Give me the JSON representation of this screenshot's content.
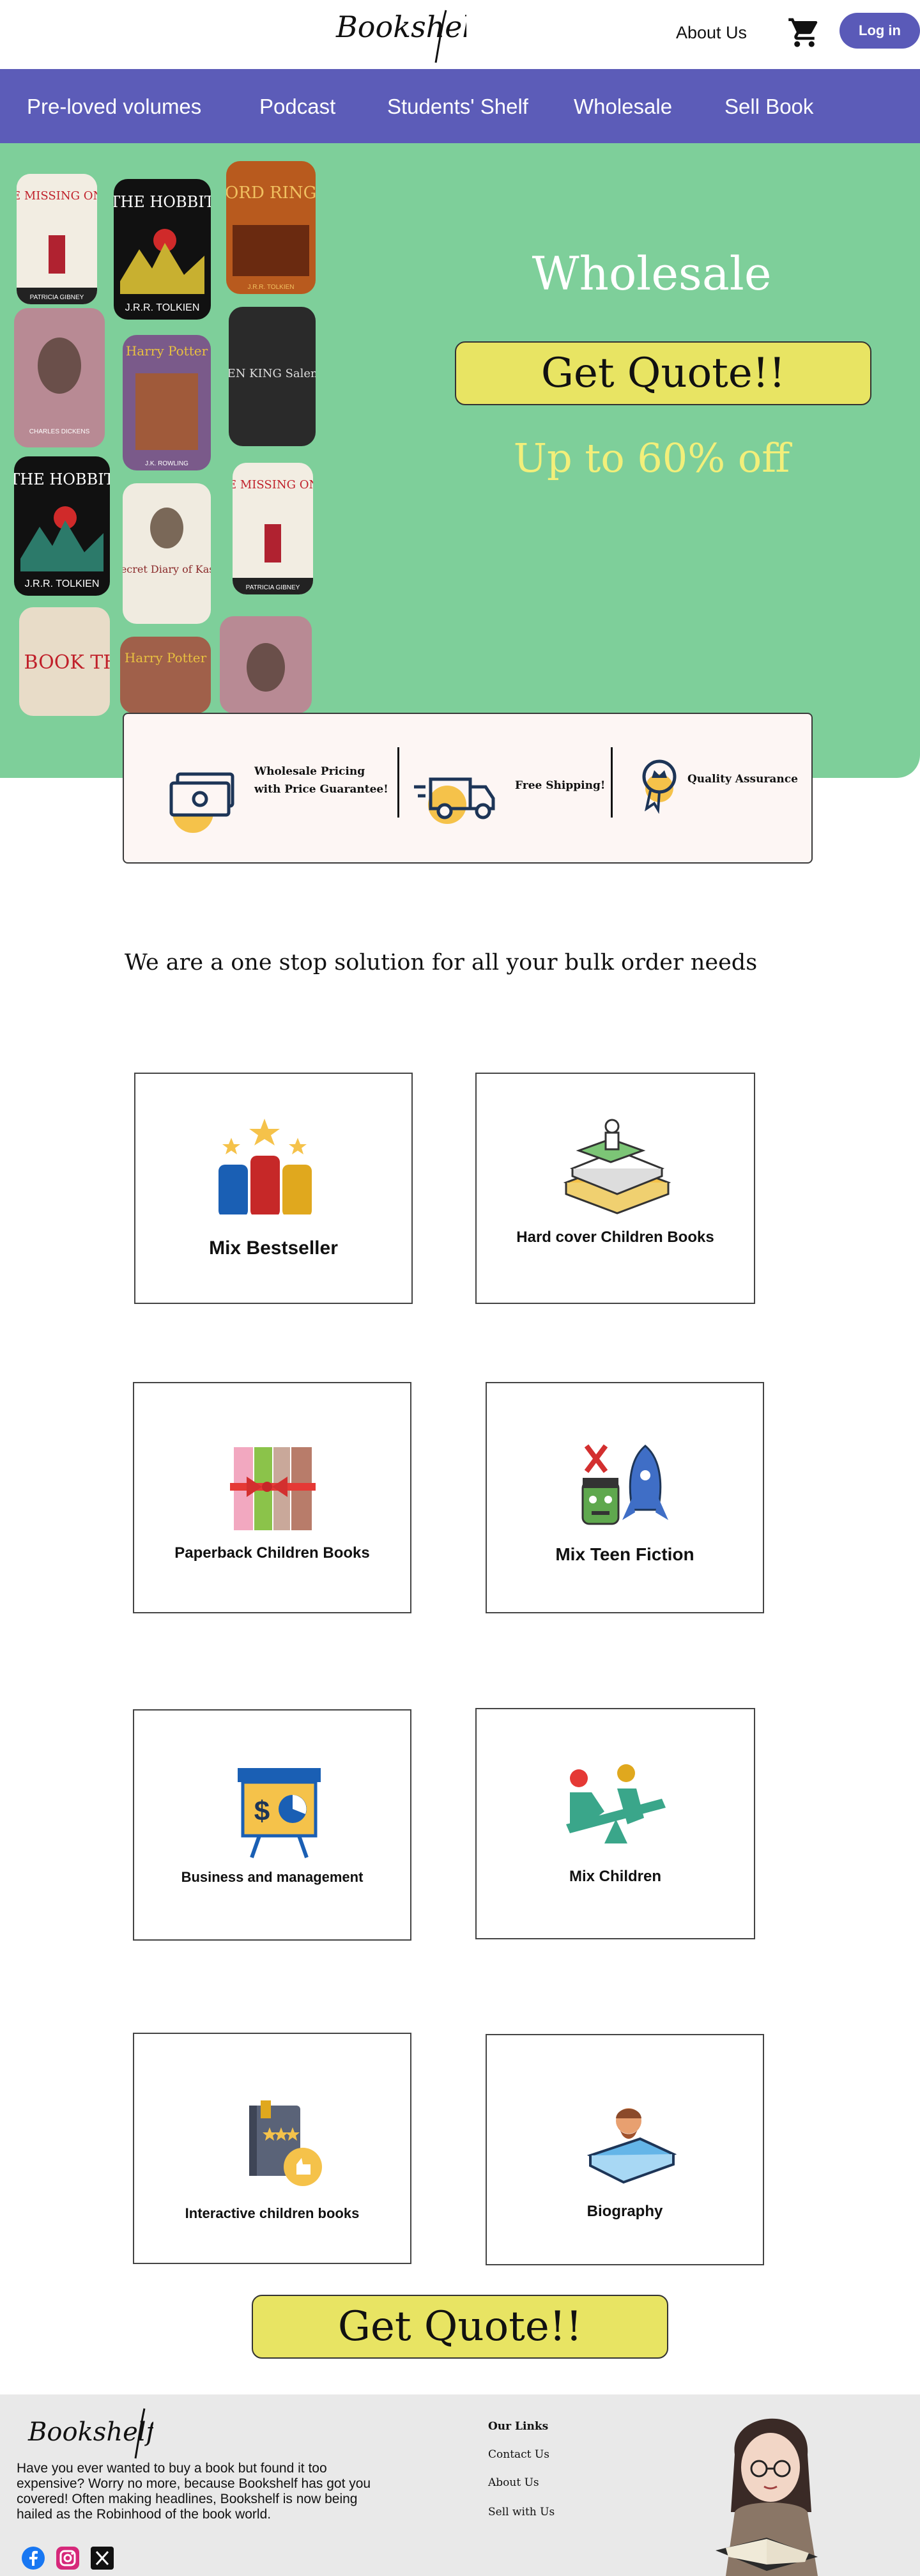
{
  "header": {
    "logo_text": "Bookshelf",
    "about_label": "About Us",
    "login_label": "Log in"
  },
  "nav": {
    "items": [
      "Pre-loved volumes",
      "Podcast",
      "Students' Shelf",
      "Wholesale",
      "Sell Book"
    ]
  },
  "hero": {
    "title": "Wholesale",
    "cta_label": "Get Quote!!",
    "subtitle": "Up to 60% off",
    "book_covers": [
      {
        "title": "THE MISSING ONES",
        "author": "PATRICIA GIBNEY"
      },
      {
        "title": "THE HOBBIT",
        "author": "J.R.R. TOLKIEN"
      },
      {
        "title": "LORD RINGS",
        "author": "J.R.R. TOLKIEN"
      },
      {
        "title": "",
        "author": "CHARLES DICKENS"
      },
      {
        "title": "Harry Potter",
        "author": "J.K. ROWLING"
      },
      {
        "title": "STEPHEN KING Salem's LOT",
        "author": ""
      },
      {
        "title": "THE HOBBIT",
        "author": "J.R.R. TOLKIEN"
      },
      {
        "title": "The Secret Diary of Kasturba",
        "author": ""
      },
      {
        "title": "THE MISSING ONES",
        "author": "PATRICIA GIBNEY"
      },
      {
        "title": "THE BOOK THIEF",
        "author": ""
      },
      {
        "title": "Harry Potter",
        "author": ""
      },
      {
        "title": "",
        "author": ""
      }
    ]
  },
  "features": {
    "pricing": [
      "Wholesale Pricing",
      "with Price Guarantee!"
    ],
    "shipping": "Free Shipping!",
    "quality": "Quality Assurance"
  },
  "tagline": "We are a one stop solution for all your bulk order needs",
  "categories": [
    {
      "label": "Mix Bestseller",
      "icon": "bestseller-icon"
    },
    {
      "label": "Hard cover Children Books",
      "icon": "hardcover-books-icon"
    },
    {
      "label": "Paperback Children Books",
      "icon": "paperback-books-icon"
    },
    {
      "label": "Mix Teen Fiction",
      "icon": "teen-fiction-icon"
    },
    {
      "label": "Business and management",
      "icon": "business-chart-icon"
    },
    {
      "label": "Mix Children",
      "icon": "seesaw-icon"
    },
    {
      "label": "Interactive children books",
      "icon": "interactive-book-icon"
    },
    {
      "label": "Biography",
      "icon": "biography-icon"
    }
  ],
  "bottom_cta_label": "Get Quote!!",
  "footer": {
    "logo_text": "Bookshelf",
    "blurb": "Have you ever wanted to buy a book but found it too expensive? Worry no more, because Bookshelf has got you covered! Often making headlines, Bookshelf is now being hailed as the Robinhood of the book world.",
    "links_title": "Our Links",
    "links": [
      "Contact Us",
      "About Us",
      "Sell with Us"
    ],
    "socials": [
      "facebook-icon",
      "instagram-icon",
      "x-icon"
    ]
  },
  "colors": {
    "nav": "#5c5cb8",
    "hero": "#7ecf9a",
    "cta": "#e8e463",
    "subtitle": "#f2ef7a",
    "footer": "#e9e9e9"
  }
}
